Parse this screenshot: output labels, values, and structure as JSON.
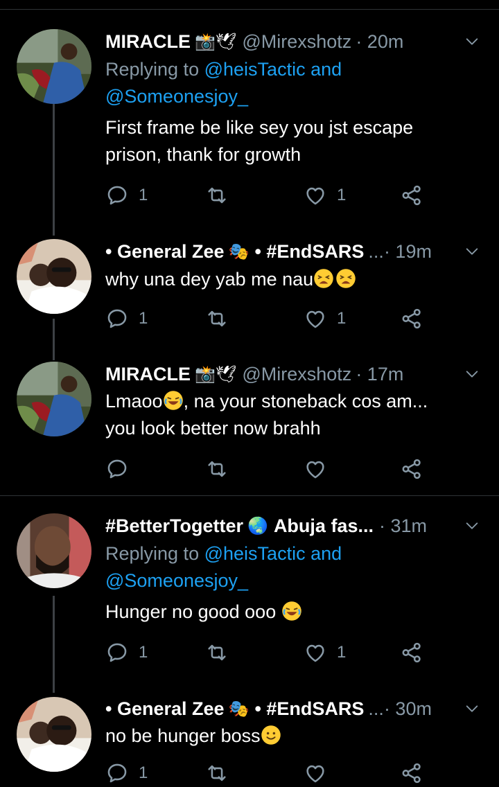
{
  "tweets": [
    {
      "name": "MIRACLE",
      "name_emojis": "📸🕊",
      "handle": "@Mirexshotz",
      "time": "· 20m",
      "replying_prefix": "Replying to",
      "replying_1": "@heisTactic and",
      "replying_2": "@Someonesjoy_",
      "text_1": "First frame be like sey you jst escape",
      "text_2": "prison, thank for growth",
      "reply_count": "1",
      "retweet_count": "",
      "like_count": "1"
    },
    {
      "name": "• General Zee",
      "name_emojis": "🎭",
      "tag": "• #EndSARS",
      "ellipsis": "...",
      "time": "· 19m",
      "text_1": "why una dey yab me nau",
      "text_emojis": "😩😩",
      "reply_count": "1",
      "retweet_count": "",
      "like_count": "1"
    },
    {
      "name": "MIRACLE",
      "name_emojis": "📸🕊",
      "handle": "@Mirexshotz",
      "time": "· 17m",
      "text_1a": "Lmaoo",
      "text_1b": ",  na your stoneback cos am...",
      "text_2": "you look better now brahh",
      "reply_count": "",
      "retweet_count": "",
      "like_count": ""
    },
    {
      "name": "#BetterTogetter",
      "name_emojis": "🌏",
      "location": "Abuja fas...",
      "time": "· 31m",
      "replying_prefix": "Replying to",
      "replying_1": "@heisTactic and",
      "replying_2": "@Someonesjoy_",
      "text_1": "Hunger no good ooo",
      "reply_count": "1",
      "retweet_count": "",
      "like_count": "1"
    },
    {
      "name": "• General Zee",
      "name_emojis": "🎭",
      "tag": "• #EndSARS",
      "ellipsis": "...",
      "time": "· 30m",
      "text_1": "no be hunger boss",
      "reply_count": "1",
      "retweet_count": "",
      "like_count": ""
    }
  ],
  "colors": {
    "background": "#000000",
    "secondary_text": "#8899a6",
    "link": "#1da1f2",
    "divider": "#2f3336"
  }
}
